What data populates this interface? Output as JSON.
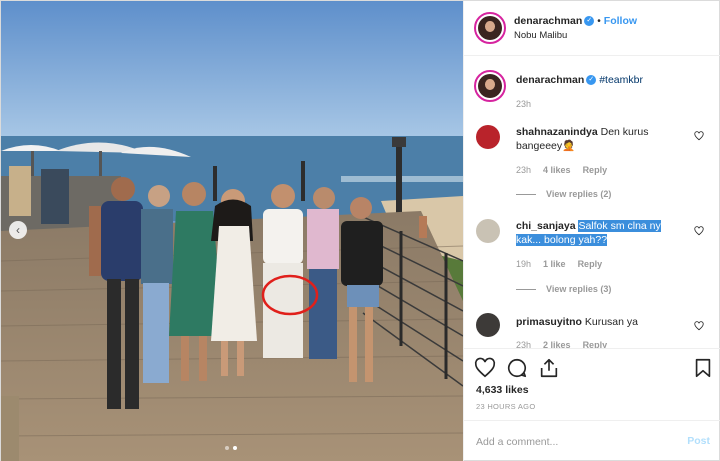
{
  "post": {
    "image_alt": "Group photo on a boardwalk by the sea",
    "carousel": {
      "count": 2,
      "active": 2
    }
  },
  "header": {
    "username": "denarachman",
    "verified": true,
    "separator": "•",
    "follow_label": "Follow",
    "location": "Nobu Malibu"
  },
  "caption": {
    "username": "denarachman",
    "text": "#teamkbr",
    "time": "23h"
  },
  "comments": [
    {
      "username": "shahnazanindya",
      "text": "Den kurus bangeeey🤦",
      "time": "23h",
      "likes": "4 likes",
      "reply_label": "Reply",
      "view_replies": "View replies (2)"
    },
    {
      "username": "chi_sanjaya",
      "text_highlighted": "Salfok sm clna ny kak... bolong yah??",
      "time": "19h",
      "likes": "1 like",
      "reply_label": "Reply",
      "view_replies": "View replies (3)"
    },
    {
      "username": "primasuyitno",
      "text": "Kurusan ya",
      "time": "23h",
      "likes": "2 likes",
      "reply_label": "Reply"
    }
  ],
  "actions": {
    "likes_count": "4,633 likes",
    "timestamp": "23 HOURS AGO"
  },
  "add_comment": {
    "placeholder": "Add a comment...",
    "post_label": "Post"
  },
  "colors": {
    "accent": "#3897f0",
    "highlight": "#3b8edc",
    "annotation_circle": "#e0201b"
  },
  "icons": [
    "heart-icon",
    "comment-icon",
    "share-icon",
    "bookmark-icon",
    "verified-badge-icon",
    "chevron-left-icon"
  ]
}
